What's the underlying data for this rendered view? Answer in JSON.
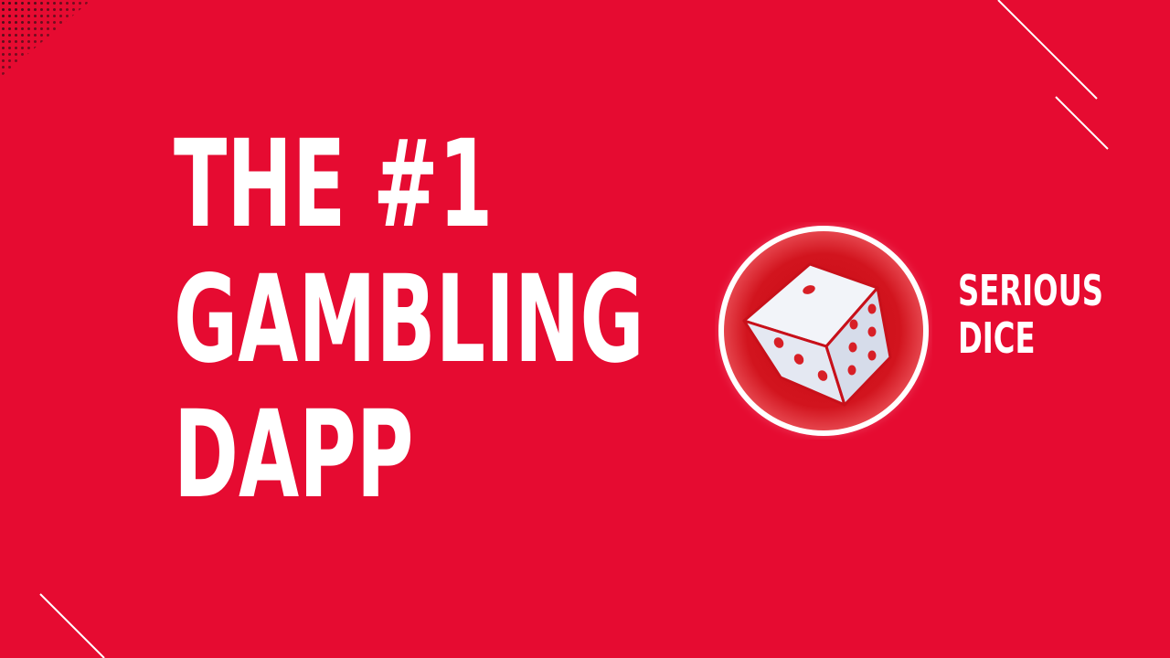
{
  "colors": {
    "background": "#E60B31",
    "text": "#FFFFFF",
    "dots": "#3A0E16",
    "badge_fill": "#D10F1A",
    "die_face": "#F2F4F9",
    "die_side": "#D6DCEA",
    "pip": "#D81F26"
  },
  "headline": {
    "lines": [
      "THE #1",
      "GAMBLING",
      "DAPP"
    ]
  },
  "brand": {
    "lines": [
      "SERIOUS",
      "DICE"
    ],
    "logo_icon": "dice-icon"
  }
}
